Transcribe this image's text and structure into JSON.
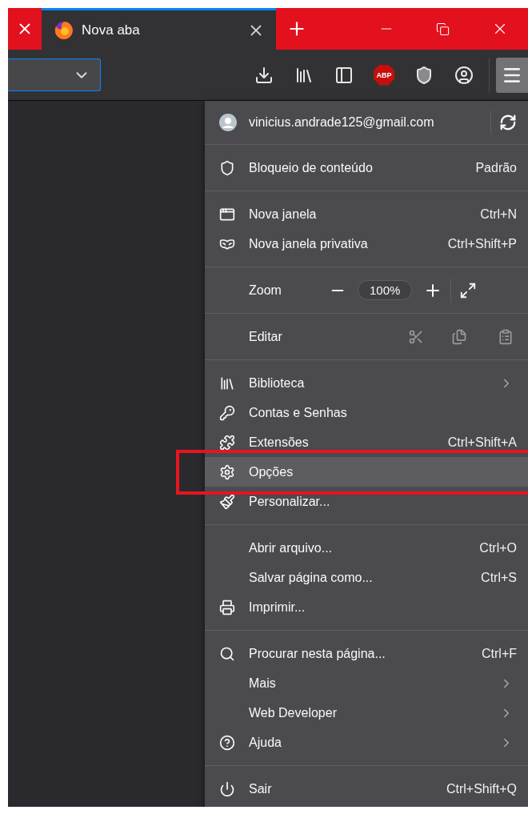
{
  "tab_strip": {
    "tabs": [
      {
        "title": "Nova aba",
        "selected": true
      }
    ]
  },
  "toolbar": {
    "badges": [
      {
        "label": "ABP"
      }
    ],
    "menu_open": true
  },
  "app_menu": {
    "highlight_frame": true,
    "sections": [
      {
        "items": [
          {
            "kind": "account",
            "label": "vinicius.andrade125@gmail.com",
            "selected": false
          }
        ]
      },
      {
        "items": [
          {
            "kind": "item",
            "label": "Bloqueio de conteúdo",
            "shortcut": "Padrão",
            "submenu": false,
            "selected": false
          }
        ]
      },
      {
        "items": [
          {
            "kind": "item",
            "label": "Nova janela",
            "shortcut": "Ctrl+N",
            "submenu": false,
            "selected": false
          },
          {
            "kind": "item",
            "label": "Nova janela privativa",
            "shortcut": "Ctrl+Shift+P",
            "submenu": false,
            "selected": false
          }
        ]
      },
      {
        "items": [
          {
            "kind": "zoom",
            "label": "Zoom",
            "value": "100%",
            "selected": false
          }
        ]
      },
      {
        "items": [
          {
            "kind": "edit",
            "label": "Editar",
            "disabled": true,
            "selected": false
          }
        ]
      },
      {
        "items": [
          {
            "kind": "item",
            "label": "Biblioteca",
            "submenu": true,
            "selected": false
          },
          {
            "kind": "item",
            "label": "Contas e Senhas",
            "submenu": false,
            "selected": false
          },
          {
            "kind": "item",
            "label": "Extensões",
            "shortcut": "Ctrl+Shift+A",
            "submenu": false,
            "selected": false
          },
          {
            "kind": "item",
            "label": "Opções",
            "submenu": false,
            "selected": true
          },
          {
            "kind": "item",
            "label": "Personalizar...",
            "submenu": false,
            "selected": false
          }
        ]
      },
      {
        "items": [
          {
            "kind": "item",
            "label": "Abrir arquivo...",
            "shortcut": "Ctrl+O",
            "submenu": false,
            "selected": false
          },
          {
            "kind": "item",
            "label": "Salvar página como...",
            "shortcut": "Ctrl+S",
            "submenu": false,
            "selected": false
          },
          {
            "kind": "item",
            "label": "Imprimir...",
            "submenu": false,
            "selected": false
          }
        ]
      },
      {
        "items": [
          {
            "kind": "item",
            "label": "Procurar nesta página...",
            "shortcut": "Ctrl+F",
            "submenu": false,
            "selected": false
          },
          {
            "kind": "item",
            "label": "Mais",
            "submenu": true,
            "selected": false
          },
          {
            "kind": "item",
            "label": "Web Developer",
            "submenu": true,
            "selected": false
          },
          {
            "kind": "item",
            "label": "Ajuda",
            "submenu": true,
            "selected": false
          }
        ]
      },
      {
        "items": [
          {
            "kind": "item",
            "label": "Sair",
            "shortcut": "Ctrl+Shift+Q",
            "submenu": false,
            "selected": false
          }
        ]
      }
    ]
  }
}
